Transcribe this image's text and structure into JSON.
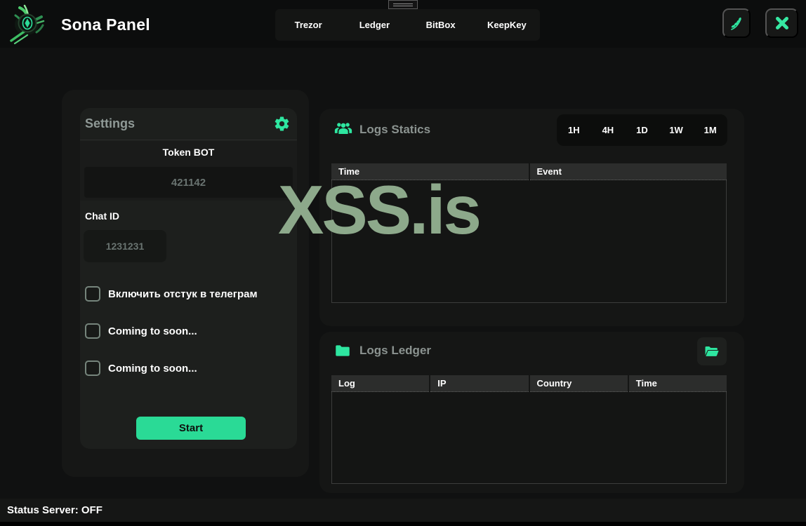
{
  "app_title": "Sona Panel",
  "nav_tabs": [
    {
      "label": "Trezor"
    },
    {
      "label": "Ledger"
    },
    {
      "label": "BitBox"
    },
    {
      "label": "KeepKey"
    }
  ],
  "settings": {
    "title": "Settings",
    "token_label": "Token BOT",
    "token_value": "421142",
    "chat_label": "Chat ID",
    "chat_value": "1231231",
    "checkboxes": [
      {
        "label": "Включить отстук в телеграм",
        "checked": false
      },
      {
        "label": "Coming to soon...",
        "checked": false
      },
      {
        "label": "Coming to soon...",
        "checked": false
      }
    ],
    "start_label": "Start"
  },
  "logs_statics": {
    "title": "Logs Statics",
    "filters": [
      "1H",
      "4H",
      "1D",
      "1W",
      "1M"
    ],
    "columns": [
      "Time",
      "Event"
    ],
    "rows": []
  },
  "logs_ledger": {
    "title": "Logs Ledger",
    "columns": [
      "Log",
      "IP",
      "Country",
      "Time"
    ],
    "rows": []
  },
  "watermark": "XSS.is",
  "status_bar": {
    "text": "Status Server: OFF"
  },
  "icons": {
    "header": [
      "plant-icon",
      "close-icon"
    ],
    "settings": [
      "gear-icon"
    ],
    "logs_statics": [
      "users-icon"
    ],
    "logs_ledger": [
      "folder-icon",
      "folder-open-icon"
    ]
  },
  "colors": {
    "accent_green": "#2ee6a0",
    "start_button": "#2ada96",
    "watermark_sage": "#8da98b",
    "background": "#101111"
  }
}
